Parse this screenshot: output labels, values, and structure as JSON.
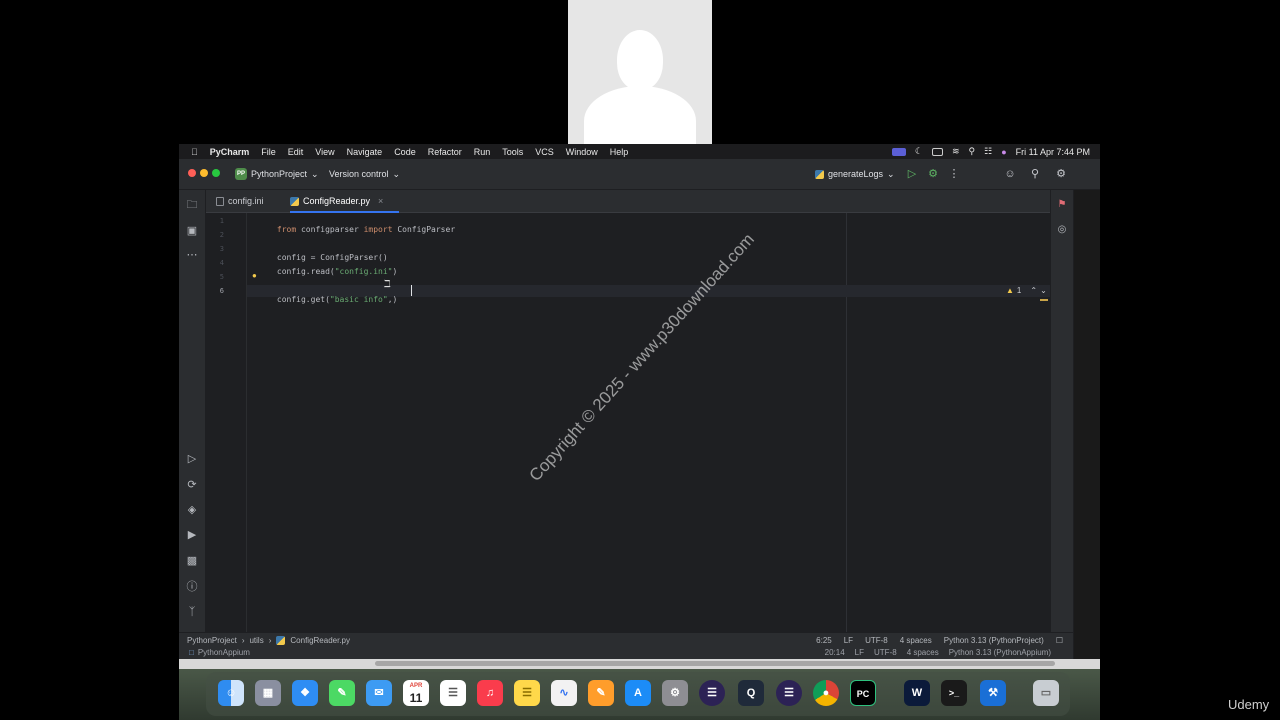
{
  "menubar": {
    "app_name": "PyCharm",
    "items": [
      "File",
      "Edit",
      "View",
      "Navigate",
      "Code",
      "Refactor",
      "Run",
      "Tools",
      "VCS",
      "Window",
      "Help"
    ],
    "clock": "Fri 11 Apr  7:44 PM"
  },
  "titlebar": {
    "project_badge": "PP",
    "project_name": "PythonProject",
    "version_control": "Version control",
    "run_config": "generateLogs"
  },
  "tabs": [
    {
      "label": "config.ini",
      "active": false
    },
    {
      "label": "ConfigReader.py",
      "active": true
    }
  ],
  "editor": {
    "line_numbers": [
      "1",
      "2",
      "3",
      "4",
      "5",
      "6"
    ],
    "lines": [
      [
        {
          "t": "from",
          "k": "kw"
        },
        {
          "t": " configparser ",
          "k": ""
        },
        {
          "t": "import",
          "k": "kw"
        },
        {
          "t": " ConfigParser",
          "k": ""
        }
      ],
      [],
      [
        {
          "t": "config = ConfigParser()",
          "k": ""
        }
      ],
      [
        {
          "t": "config.read(",
          "k": ""
        },
        {
          "t": "\"config.ini\"",
          "k": "str"
        },
        {
          "t": ")",
          "k": ""
        }
      ],
      [],
      [
        {
          "t": "config.get(",
          "k": ""
        },
        {
          "t": "\"basic info\"",
          "k": "str"
        },
        {
          "t": ",)",
          "k": ""
        }
      ]
    ],
    "warning_count": "1"
  },
  "status": {
    "breadcrumb": [
      "PythonProject",
      "utils",
      "ConfigReader.py"
    ],
    "position": "6:25",
    "line_sep": "LF",
    "encoding": "UTF-8",
    "indent": "4 spaces",
    "interpreter": "Python 3.13 (PythonProject)"
  },
  "status2": {
    "project": "PythonAppium",
    "position": "20:14",
    "line_sep": "LF",
    "encoding": "UTF-8",
    "indent": "4 spaces",
    "interpreter": "Python 3.13 (PythonAppium)"
  },
  "dock": {
    "calendar_month": "APR",
    "calendar_day": "11"
  },
  "watermark": "Copyright © 2025 - www.p30download.com",
  "brand": "Udemy",
  "colors": {
    "accent": "#3574f0",
    "keyword": "#cf8e6d",
    "string": "#6aab73"
  }
}
